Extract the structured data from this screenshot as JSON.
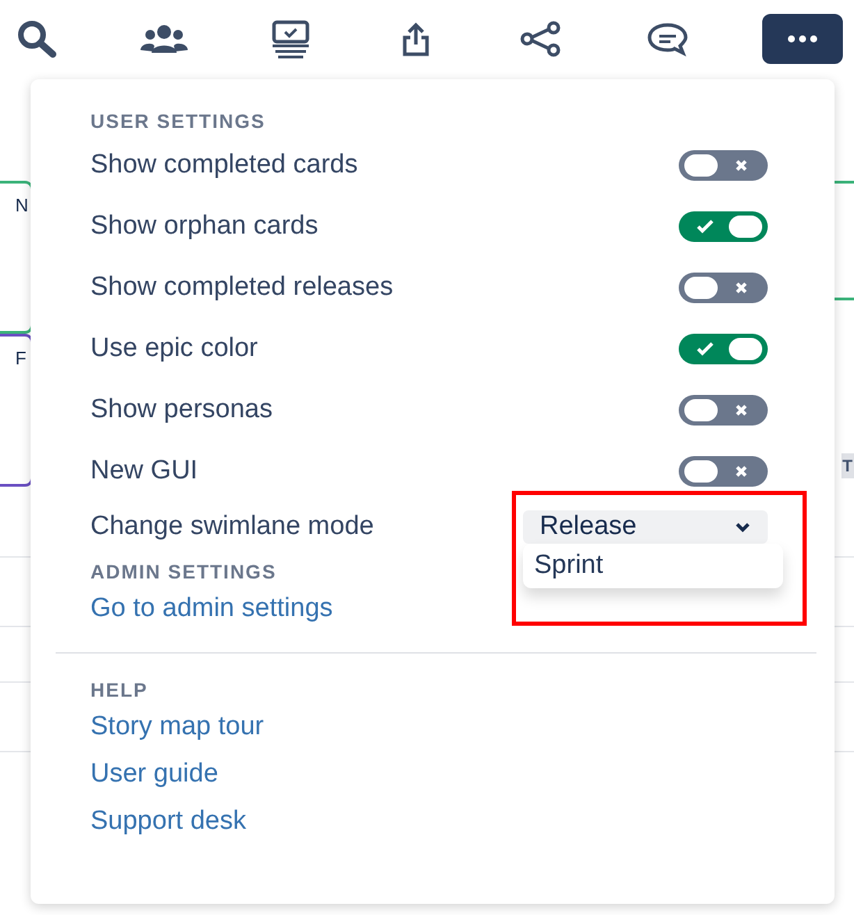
{
  "toolbar": {
    "buttons": [
      {
        "kind": "search",
        "selected": false
      },
      {
        "kind": "people",
        "selected": false
      },
      {
        "kind": "board",
        "selected": false
      },
      {
        "kind": "export",
        "selected": false
      },
      {
        "kind": "share",
        "selected": false
      },
      {
        "kind": "comment",
        "selected": false
      },
      {
        "kind": "more",
        "selected": true
      }
    ]
  },
  "background_cards": [
    {
      "text": "N",
      "color": "#3bb37a"
    },
    {
      "text": "F",
      "color": "#6a4fc2"
    }
  ],
  "background_tag": {
    "text": "T"
  },
  "menu": {
    "sections": [
      {
        "header": "USER SETTINGS",
        "items": [
          {
            "kind": "toggle",
            "label": "Show completed cards",
            "on": false
          },
          {
            "kind": "toggle",
            "label": "Show orphan cards",
            "on": true
          },
          {
            "kind": "toggle",
            "label": "Show completed releases",
            "on": false
          },
          {
            "kind": "toggle",
            "label": "Use epic color",
            "on": true
          },
          {
            "kind": "toggle",
            "label": "Show personas",
            "on": false
          },
          {
            "kind": "toggle",
            "label": "New GUI",
            "on": false
          },
          {
            "kind": "select",
            "label": "Change swimlane mode",
            "value": "Release",
            "expanded": true,
            "highlighted": true,
            "options": [
              "Sprint"
            ]
          }
        ]
      },
      {
        "header": "ADMIN SETTINGS",
        "items": [
          {
            "kind": "link",
            "label": "Go to admin settings"
          }
        ]
      },
      {
        "header": "HELP",
        "divider": true,
        "items": [
          {
            "kind": "link",
            "label": "Story map tour"
          },
          {
            "kind": "link",
            "label": "User guide"
          },
          {
            "kind": "link",
            "label": "Support desk"
          }
        ]
      }
    ]
  }
}
